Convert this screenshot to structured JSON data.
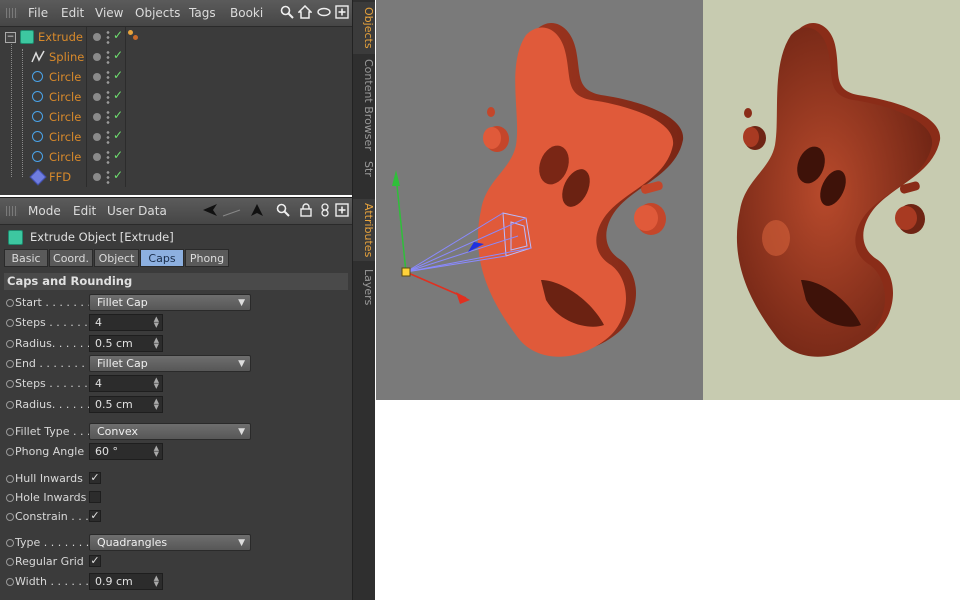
{
  "objects_menu": {
    "file": "File",
    "edit": "Edit",
    "view": "View",
    "objects": "Objects",
    "tags": "Tags",
    "bookmarks": "Booki"
  },
  "tree": [
    {
      "label": "Extrude",
      "icon": "extrude-icon"
    },
    {
      "label": "Spline",
      "icon": "spline-icon"
    },
    {
      "label": "Circle",
      "icon": "circle-icon"
    },
    {
      "label": "Circle",
      "icon": "circle-icon"
    },
    {
      "label": "Circle",
      "icon": "circle-icon"
    },
    {
      "label": "Circle",
      "icon": "circle-icon"
    },
    {
      "label": "Circle",
      "icon": "circle-icon"
    },
    {
      "label": "FFD",
      "icon": "ffd-icon"
    }
  ],
  "side_tabs": {
    "objects": "Objects",
    "content_browser": "Content Browser",
    "structure": "Str",
    "attributes": "Attributes",
    "layers": "Layers"
  },
  "attr_menu": {
    "mode": "Mode",
    "edit": "Edit",
    "user_data": "User Data"
  },
  "attr_title": "Extrude Object [Extrude]",
  "attr_tabs": [
    "Basic",
    "Coord.",
    "Object",
    "Caps",
    "Phong"
  ],
  "active_tab": "Caps",
  "section": "Caps and Rounding",
  "props": {
    "start": {
      "label": "Start . . . . . . .",
      "value": "Fillet Cap"
    },
    "steps1": {
      "label": "Steps . . . . . . .",
      "value": "4"
    },
    "radius1": {
      "label": "Radius. . . . . . .",
      "value": "0.5 cm"
    },
    "end": {
      "label": "End . . . . . . . .",
      "value": "Fillet Cap"
    },
    "steps2": {
      "label": "Steps . . . . . . .",
      "value": "4"
    },
    "radius2": {
      "label": "Radius. . . . . . .",
      "value": "0.5 cm"
    },
    "fillet_type": {
      "label": "Fillet Type . . .",
      "value": "Convex"
    },
    "phong_angle": {
      "label": "Phong Angle",
      "value": "60 °"
    },
    "hull_inwards": {
      "label": "Hull Inwards",
      "checked": true
    },
    "hole_inwards": {
      "label": "Hole Inwards",
      "checked": false
    },
    "constrain": {
      "label": "Constrain . . . .",
      "checked": true
    },
    "type": {
      "label": "Type . . . . . . .",
      "value": "Quadrangles"
    },
    "regular_grid": {
      "label": "Regular Grid",
      "checked": true
    },
    "width": {
      "label": "Width . . . . . .",
      "value": "0.9 cm"
    }
  },
  "colors": {
    "object_orange": "#e05a3a",
    "label_orange": "#d98a2b",
    "viewport_gray": "#7a7a7a",
    "render_bg": "#c7cbb0",
    "active_tab": "#8db0e0"
  }
}
